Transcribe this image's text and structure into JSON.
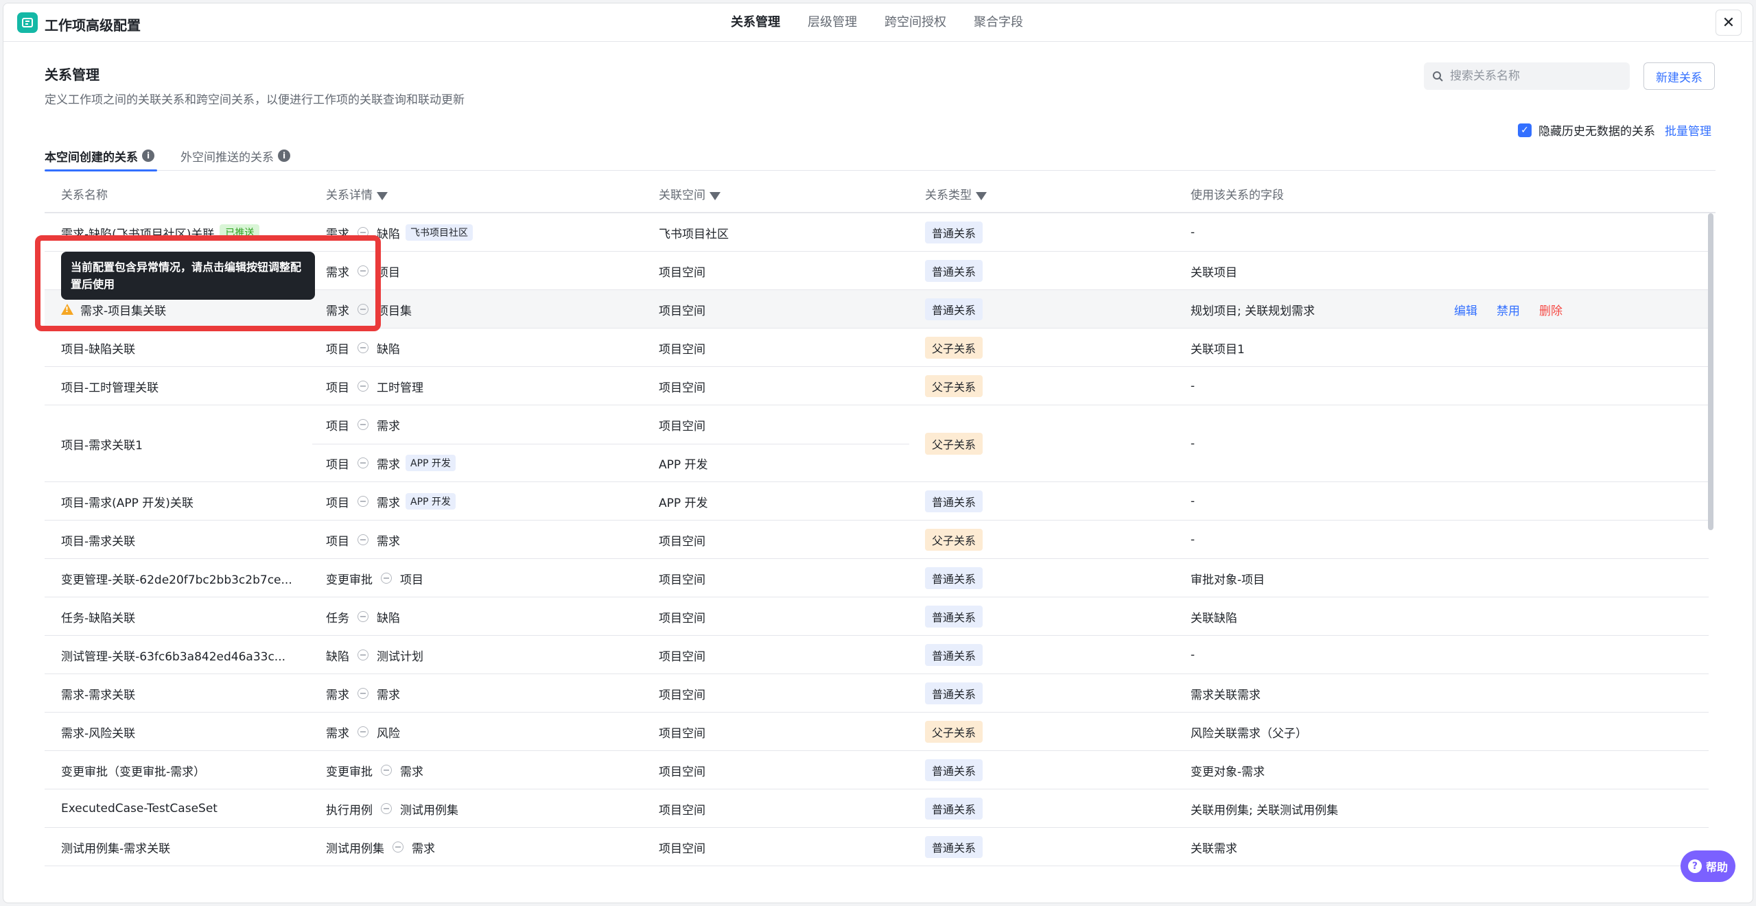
{
  "app": {
    "title": "工作项高级配置"
  },
  "nav": [
    {
      "label": "关系管理"
    },
    {
      "label": "层级管理"
    },
    {
      "label": "跨空间授权"
    },
    {
      "label": "聚合字段"
    }
  ],
  "page": {
    "title": "关系管理",
    "desc": "定义工作项之间的关联关系和跨空间关系，以便进行工作项的关联查询和联动更新"
  },
  "search": {
    "placeholder": "搜索关系名称"
  },
  "new_button": "新建关系",
  "hide_checkbox": {
    "label": "隐藏历史无数据的关系",
    "checked": true
  },
  "batch_link": "批量管理",
  "tabs": [
    {
      "label": "本空间创建的关系"
    },
    {
      "label": "外空间推送的关系"
    }
  ],
  "columns": {
    "name": "关系名称",
    "detail": "关系详情",
    "space": "关联空间",
    "type": "关系类型",
    "field": "使用该关系的字段"
  },
  "tooltip": "当前配置包含异常情况，请点击编辑按钮调整配置后使用",
  "rows": [
    {
      "name": "需求-缺陷(飞书项目社区)关联",
      "badge": "已推送",
      "from": "需求",
      "to": "缺陷",
      "to_tag": "飞书项目社区",
      "space": "飞书项目社区",
      "type": "普通关系",
      "field": "-"
    },
    {
      "name": "",
      "from": "需求",
      "to": "项目",
      "space": "项目空间",
      "type": "普通关系",
      "field": "关联项目"
    },
    {
      "name": "需求-项目集关联",
      "from": "需求",
      "to": "项目集",
      "space": "项目空间",
      "type": "普通关系",
      "field": "规划项目; 关联规划需求",
      "actions": [
        "编辑",
        "禁用",
        "删除"
      ]
    },
    {
      "name": "项目-缺陷关联",
      "from": "项目",
      "to": "缺陷",
      "space": "项目空间",
      "type": "父子关系",
      "field": "关联项目1"
    },
    {
      "name": "项目-工时管理关联",
      "from": "项目",
      "to": "工时管理",
      "space": "项目空间",
      "type": "父子关系",
      "field": "-"
    },
    {
      "name": "项目-需求关联1",
      "sub": [
        {
          "from": "项目",
          "to": "需求",
          "space": "项目空间"
        },
        {
          "from": "项目",
          "to": "需求",
          "to_tag": "APP 开发",
          "space": "APP 开发"
        }
      ],
      "type": "父子关系",
      "field": "-"
    },
    {
      "name": "项目-需求(APP 开发)关联",
      "from": "项目",
      "to": "需求",
      "to_tag": "APP 开发",
      "space": "APP 开发",
      "type": "普通关系",
      "field": "-"
    },
    {
      "name": "项目-需求关联",
      "from": "项目",
      "to": "需求",
      "space": "项目空间",
      "type": "父子关系",
      "field": "-"
    },
    {
      "name": "变更管理-关联-62de20f7bc2bb3c2b7ce...",
      "from": "变更审批",
      "to": "项目",
      "space": "项目空间",
      "type": "普通关系",
      "field": "审批对象-项目"
    },
    {
      "name": "任务-缺陷关联",
      "from": "任务",
      "to": "缺陷",
      "space": "项目空间",
      "type": "普通关系",
      "field": "关联缺陷"
    },
    {
      "name": "测试管理-关联-63fc6b3a842ed46a33c...",
      "from": "缺陷",
      "to": "测试计划",
      "space": "项目空间",
      "type": "普通关系",
      "field": "-"
    },
    {
      "name": "需求-需求关联",
      "from": "需求",
      "to": "需求",
      "space": "项目空间",
      "type": "普通关系",
      "field": "需求关联需求"
    },
    {
      "name": "需求-风险关联",
      "from": "需求",
      "to": "风险",
      "space": "项目空间",
      "type": "父子关系",
      "field": "风险关联需求（父子）"
    },
    {
      "name": "变更审批（变更审批-需求）",
      "from": "变更审批",
      "to": "需求",
      "space": "项目空间",
      "type": "普通关系",
      "field": "变更对象-需求"
    },
    {
      "name": "ExecutedCase-TestCaseSet",
      "from": "执行用例",
      "to": "测试用例集",
      "space": "项目空间",
      "type": "普通关系",
      "field": "关联用例集; 关联测试用例集"
    },
    {
      "name": "测试用例集-需求关联",
      "from": "测试用例集",
      "to": "需求",
      "space": "项目空间",
      "type": "普通关系",
      "field": "关联需求"
    }
  ],
  "help": "帮助"
}
